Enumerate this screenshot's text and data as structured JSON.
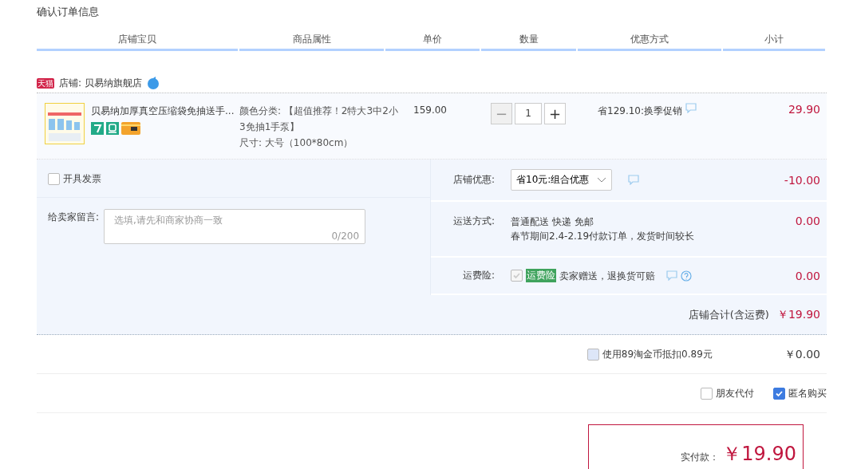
{
  "title": "确认订单信息",
  "columns": [
    "店铺宝贝",
    "商品属性",
    "单价",
    "数量",
    "优惠方式",
    "小计"
  ],
  "shop": {
    "badge": "天猫",
    "name": "店铺: 贝易纳旗舰店"
  },
  "item": {
    "title": "贝易纳加厚真空压缩袋免抽送手...",
    "attributes": [
      "颜色分类: 【超值推荐！2特大3中2小3免抽1手泵】",
      "尺寸: 大号（100*80cm）"
    ],
    "price": "159.00",
    "quantity": "1",
    "minus": "−",
    "plus": "+",
    "promotion": "省129.10:换季促销",
    "subtotal": "29.90"
  },
  "invoice": {
    "label": "开具发票",
    "checked": false
  },
  "message": {
    "label": "给卖家留言:",
    "placeholder": "选填,请先和商家协商一致",
    "counter": "0/200"
  },
  "shop_discount": {
    "label": "店铺优惠:",
    "value": "省10元:组合优惠",
    "amount": "-10.00"
  },
  "shipping": {
    "label": "运送方式:",
    "lines": [
      "普通配送 快递 免邮",
      "春节期间2.4-2.19付款订单，发货时间较长"
    ],
    "amount": "0.00"
  },
  "insurance": {
    "label": "运费险:",
    "checked": true,
    "disabled": true,
    "tag": "运费险",
    "text": "卖家赠送，退换货可赔",
    "amount": "0.00"
  },
  "shop_total": {
    "label": "店铺合计(含运费)",
    "amount": "￥19.90"
  },
  "coins": {
    "label": "使用89淘金币抵扣0.89元",
    "checked": false,
    "amount": "￥0.00"
  },
  "options": [
    {
      "label": "朋友代付",
      "checked": false
    },
    {
      "label": "匿名购买",
      "checked": true
    }
  ],
  "payment": {
    "label": "实付款：",
    "amount": "￥19.90"
  }
}
